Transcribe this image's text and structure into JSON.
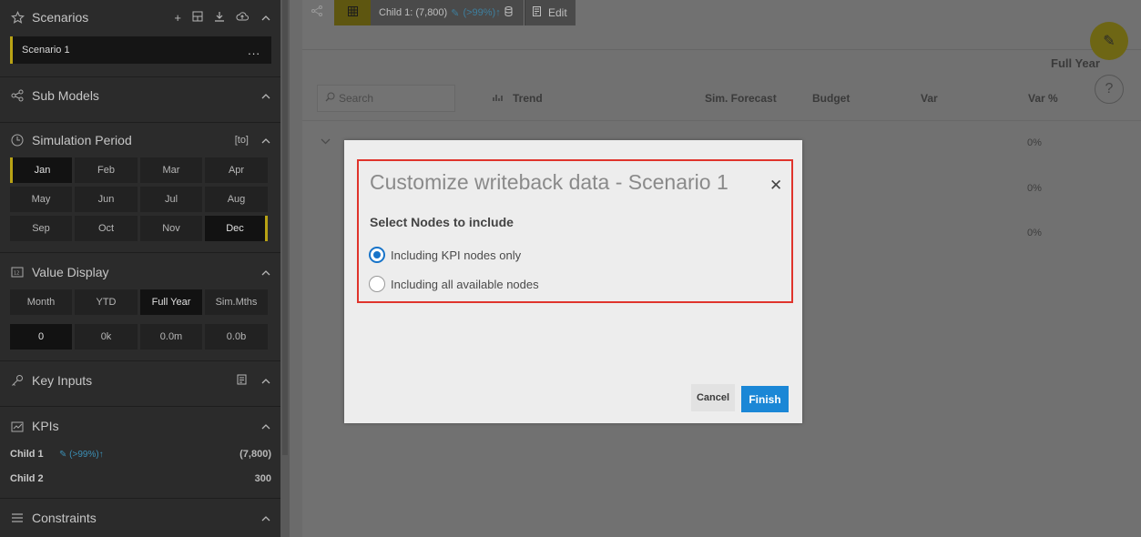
{
  "sidebar": {
    "scenarios": {
      "title": "Scenarios",
      "items": [
        {
          "name": "Scenario 1",
          "more": "..."
        }
      ]
    },
    "sub_models": {
      "title": "Sub Models"
    },
    "simulation_period": {
      "title": "Simulation Period",
      "tag": "[to]",
      "months": [
        "Jan",
        "Feb",
        "Mar",
        "Apr",
        "May",
        "Jun",
        "Jul",
        "Aug",
        "Sep",
        "Oct",
        "Nov",
        "Dec"
      ]
    },
    "value_display": {
      "title": "Value Display",
      "modes": [
        "Month",
        "YTD",
        "Full Year",
        "Sim.Mths"
      ],
      "selected_mode": "Full Year",
      "formats": [
        "0",
        "0k",
        "0.0m",
        "0.0b"
      ],
      "selected_format": "0"
    },
    "key_inputs": {
      "title": "Key Inputs"
    },
    "kpis": {
      "title": "KPIs",
      "rows": [
        {
          "label": "Child 1",
          "badge": "(>99%)↑",
          "value": "(7,800)"
        },
        {
          "label": "Child 2",
          "badge": "",
          "value": "300"
        }
      ]
    },
    "constraints": {
      "title": "Constraints"
    }
  },
  "toolbar": {
    "child_label": "Child 1: (7,800)",
    "child_badge": "(>99%)↑",
    "edit_label": "Edit"
  },
  "table": {
    "period_header": "Full Year",
    "search_placeholder": "Search",
    "columns": [
      "Trend",
      "Sim. Forecast",
      "Budget",
      "Var",
      "Var %"
    ],
    "var_pct_values": [
      "0%",
      "0%",
      "0%"
    ]
  },
  "dialog": {
    "title": "Customize writeback data - Scenario 1",
    "subtitle": "Select Nodes to include",
    "options": [
      {
        "label": "Including KPI nodes only",
        "selected": true
      },
      {
        "label": "Including all available nodes",
        "selected": false
      }
    ],
    "cancel_label": "Cancel",
    "finish_label": "Finish"
  },
  "colors": {
    "accent_yellow": "#b8a214",
    "primary_blue": "#1b87d6",
    "highlight_red": "#e0342c"
  }
}
